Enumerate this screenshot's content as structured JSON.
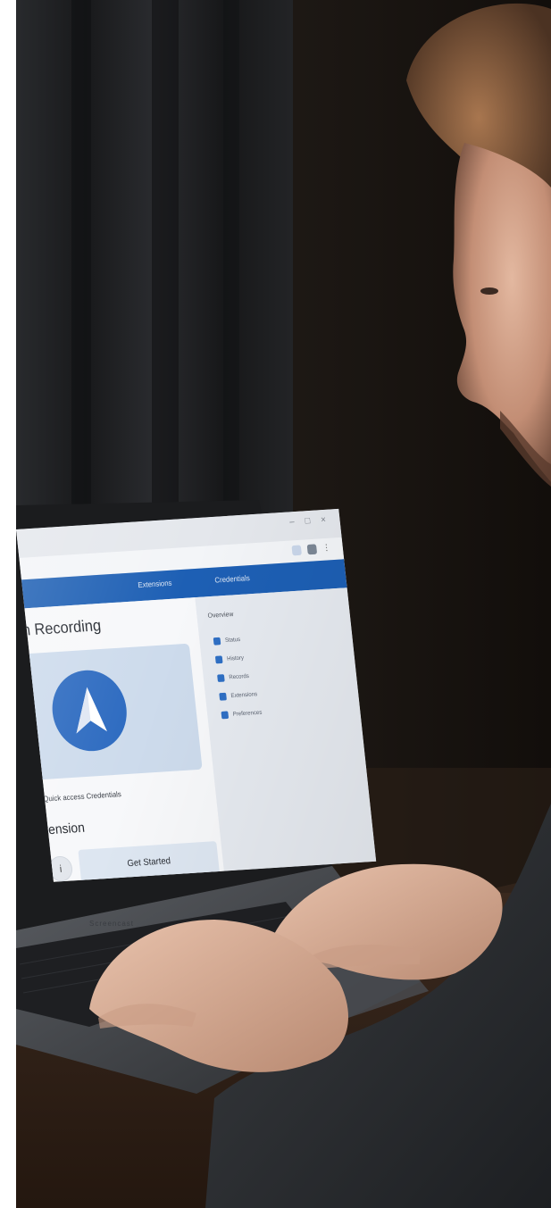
{
  "screen": {
    "page_title": "n Recording",
    "nav_links": [
      "Extensions",
      "Credentials"
    ],
    "caption": "Quick access Credentials",
    "section_title": "xtension",
    "action_button_label": "Get Started",
    "round_button_glyph": "i",
    "sidebar_heading": "Overview",
    "sidebar_items": [
      "Status",
      "History",
      "Records",
      "Extensions",
      "Preferences"
    ],
    "window_controls": [
      "–",
      "□",
      "×"
    ]
  },
  "laptop": {
    "brand": "Screencast"
  },
  "colors": {
    "nav_bar": "#1d5fb4",
    "logo_circle": "#2c6ac0",
    "hero_card": "#cddbec",
    "room_background": "#15110e"
  },
  "icons": {
    "logo": "navigation-arrow-icon",
    "round_button": "info-icon"
  }
}
